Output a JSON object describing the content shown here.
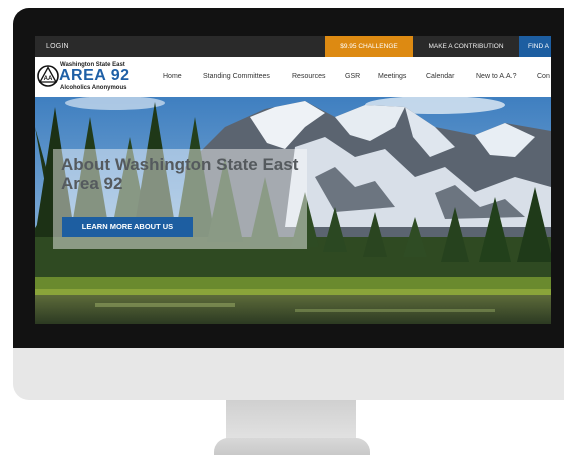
{
  "topbar": {
    "login": "LOGIN",
    "challenge": "$9.95 CHALLENGE",
    "contribution": "MAKE A CONTRIBUTION",
    "find": "FIND A"
  },
  "logo": {
    "top_text": "Washington State East",
    "area_text": "AREA 92",
    "bottom_text": "Alcoholics Anonymous",
    "emblem_text": "AA"
  },
  "nav": {
    "items": [
      "Home",
      "Standing Committees",
      "Resources",
      "GSR",
      "Meetings",
      "Calendar",
      "New to A.A.?",
      "Con"
    ]
  },
  "hero": {
    "title": "About Washington State East Area 92",
    "button": "LEARN MORE ABOUT US"
  },
  "colors": {
    "brand_blue": "#1e5fa6",
    "challenge_orange": "#dd8a12",
    "topbar_dark": "#2a2a2a"
  }
}
